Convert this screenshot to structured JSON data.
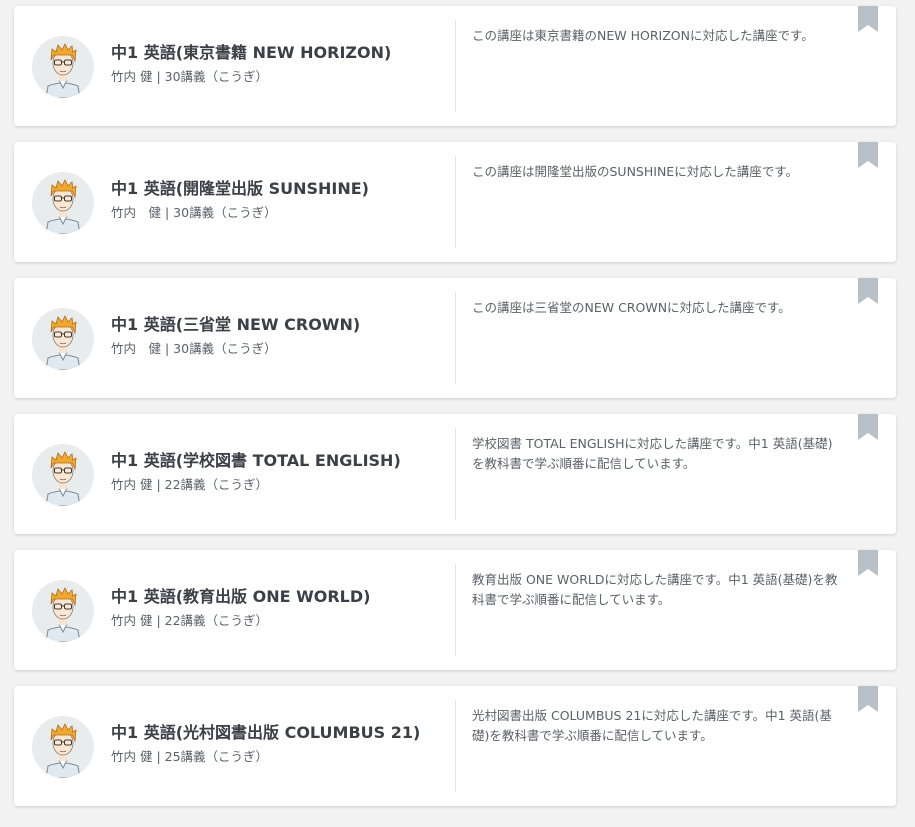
{
  "courses": [
    {
      "title": "中1 英語(東京書籍 NEW HORIZON)",
      "meta": "竹内 健 | 30講義（こうぎ）",
      "description": "この講座は東京書籍のNEW HORIZONに対応した講座です。"
    },
    {
      "title": "中1 英語(開隆堂出版 SUNSHINE)",
      "meta": "竹内　健 | 30講義（こうぎ）",
      "description": "この講座は開隆堂出版のSUNSHINEに対応した講座です。"
    },
    {
      "title": "中1 英語(三省堂 NEW CROWN)",
      "meta": "竹内　健 | 30講義（こうぎ）",
      "description": "この講座は三省堂のNEW CROWNに対応した講座です。"
    },
    {
      "title": "中1 英語(学校図書 TOTAL ENGLISH)",
      "meta": "竹内 健 | 22講義（こうぎ）",
      "description": "学校図書 TOTAL ENGLISHに対応した講座です。中1 英語(基礎)を教科書で学ぶ順番に配信しています。"
    },
    {
      "title": "中1 英語(教育出版 ONE WORLD)",
      "meta": "竹内 健 | 22講義（こうぎ）",
      "description": "教育出版 ONE WORLDに対応した講座です。中1 英語(基礎)を教科書で学ぶ順番に配信しています。"
    },
    {
      "title": "中1 英語(光村図書出版 COLUMBUS 21)",
      "meta": "竹内 健 | 25講義（こうぎ）",
      "description": "光村図書出版 COLUMBUS 21に対応した講座です。中1 英語(基礎)を教科書で学ぶ順番に配信しています。"
    }
  ],
  "icons": {
    "bookmark": "bookmark-icon",
    "avatar": "teacher-avatar"
  },
  "colors": {
    "bookmark": "#b8c1c9",
    "hair": "#f0a830",
    "title": "#3b4046"
  }
}
